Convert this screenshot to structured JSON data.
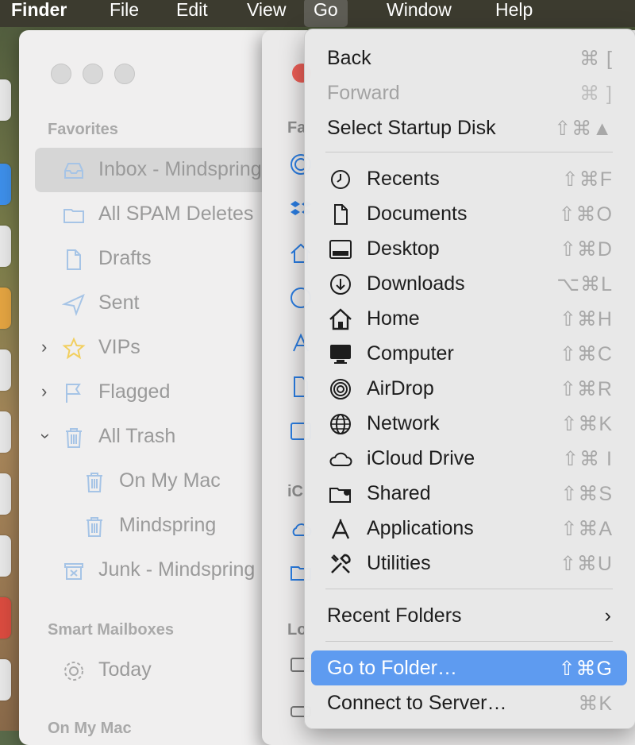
{
  "menubar": {
    "app": "Finder",
    "items": [
      "File",
      "Edit",
      "View",
      "Go",
      "Window",
      "Help"
    ]
  },
  "mail": {
    "favorites_header": "Favorites",
    "items": [
      {
        "label": "Inbox - Mindspring",
        "icon": "inbox-icon"
      },
      {
        "label": "All SPAM Deletes",
        "icon": "folder-icon"
      },
      {
        "label": "Drafts",
        "icon": "document-icon"
      },
      {
        "label": "Sent",
        "icon": "paper-plane-icon"
      },
      {
        "label": "VIPs",
        "icon": "star-icon"
      },
      {
        "label": "Flagged",
        "icon": "flag-icon"
      },
      {
        "label": "All Trash",
        "icon": "trash-icon"
      },
      {
        "label": "On My Mac",
        "icon": "trash-icon"
      },
      {
        "label": "Mindspring",
        "icon": "trash-icon"
      },
      {
        "label": "Junk - Mindspring",
        "icon": "junk-icon"
      }
    ],
    "smart_header": "Smart Mailboxes",
    "today": "Today",
    "onmymac_header": "On My Mac"
  },
  "finder": {
    "favorites_header": "Fa",
    "icloud_header": "iC",
    "locations_header": "Lo"
  },
  "go_menu": {
    "back": {
      "label": "Back",
      "shortcut": "⌘ ["
    },
    "forward": {
      "label": "Forward",
      "shortcut": "⌘ ]"
    },
    "startup": {
      "label": "Select Startup Disk",
      "shortcut": "⇧⌘▲"
    },
    "places": [
      {
        "label": "Recents",
        "shortcut": "⇧⌘F",
        "icon": "clock-icon"
      },
      {
        "label": "Documents",
        "shortcut": "⇧⌘O",
        "icon": "document-icon"
      },
      {
        "label": "Desktop",
        "shortcut": "⇧⌘D",
        "icon": "desktop-icon"
      },
      {
        "label": "Downloads",
        "shortcut": "⌥⌘L",
        "icon": "download-icon"
      },
      {
        "label": "Home",
        "shortcut": "⇧⌘H",
        "icon": "home-icon"
      },
      {
        "label": "Computer",
        "shortcut": "⇧⌘C",
        "icon": "computer-icon"
      },
      {
        "label": "AirDrop",
        "shortcut": "⇧⌘R",
        "icon": "airdrop-icon"
      },
      {
        "label": "Network",
        "shortcut": "⇧⌘K",
        "icon": "globe-icon"
      },
      {
        "label": "iCloud Drive",
        "shortcut": "⇧⌘ I",
        "icon": "cloud-icon"
      },
      {
        "label": "Shared",
        "shortcut": "⇧⌘S",
        "icon": "shared-folder-icon"
      },
      {
        "label": "Applications",
        "shortcut": "⇧⌘A",
        "icon": "applications-icon"
      },
      {
        "label": "Utilities",
        "shortcut": "⇧⌘U",
        "icon": "utilities-icon"
      }
    ],
    "recent_folders": "Recent Folders",
    "go_to_folder": {
      "label": "Go to Folder…",
      "shortcut": "⇧⌘G"
    },
    "connect": {
      "label": "Connect to Server…",
      "shortcut": "⌘K"
    }
  }
}
